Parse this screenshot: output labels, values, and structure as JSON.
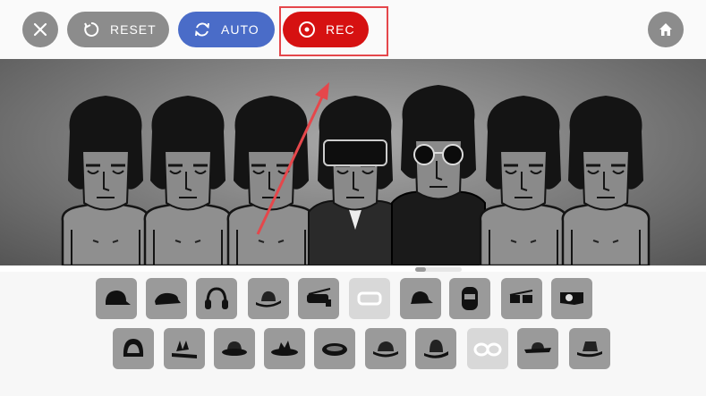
{
  "toolbar": {
    "close_icon": "close-icon",
    "reset_label": "RESET",
    "auto_label": "AUTO",
    "rec_label": "REC",
    "home_icon": "home-icon"
  },
  "colors": {
    "auto_blue": "#4a6cc8",
    "rec_red": "#d61111",
    "button_grey": "#8c8c8c",
    "annotation_red": "#e5474b"
  },
  "stage": {
    "characters": [
      {
        "name": "character-1",
        "style": "bare"
      },
      {
        "name": "character-2",
        "style": "bare"
      },
      {
        "name": "character-3",
        "style": "bare"
      },
      {
        "name": "character-4",
        "style": "visor-jacket"
      },
      {
        "name": "character-5",
        "style": "sunglasses-jacket"
      },
      {
        "name": "character-6",
        "style": "bare"
      },
      {
        "name": "character-7",
        "style": "bare"
      }
    ]
  },
  "tray": {
    "row1": [
      "cap",
      "flat-cap",
      "headphones",
      "fedora",
      "goggles",
      "visor-outline",
      "bucket-cap",
      "helmet",
      "shades",
      "camera-mask"
    ],
    "row2": [
      "hood",
      "crown-band",
      "bowler",
      "spiky-hat",
      "round-hat",
      "derby",
      "tall-hat",
      "glasses-outline",
      "wide-brim",
      "trilby"
    ]
  }
}
